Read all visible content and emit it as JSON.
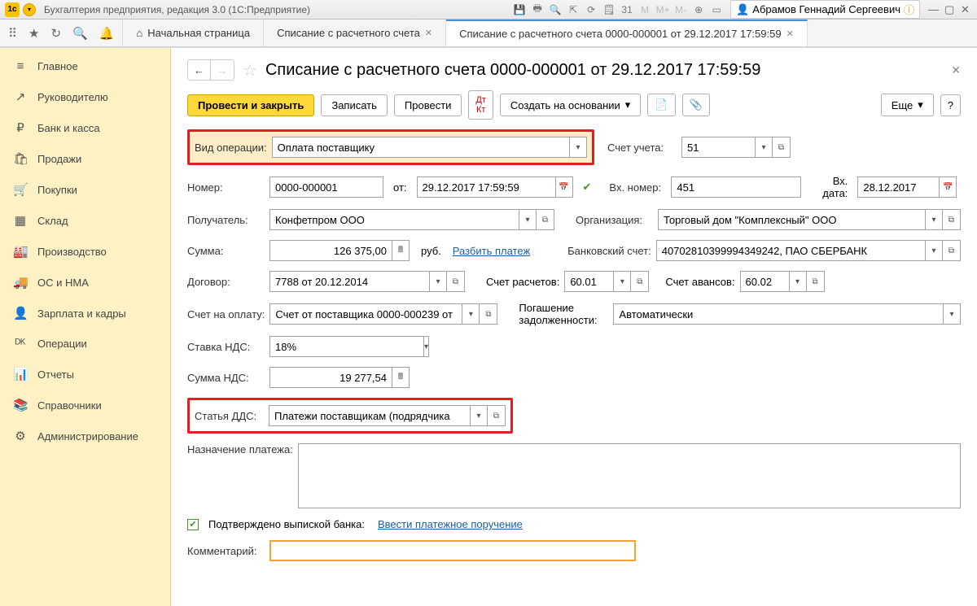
{
  "titlebar": {
    "app_title": "Бухгалтерия предприятия, редакция 3.0  (1С:Предприятие)",
    "user_name": "Абрамов Геннадий Сергеевич"
  },
  "tabs": {
    "home": "Начальная страница",
    "t1": "Списание с расчетного счета",
    "t2": "Списание с расчетного счета 0000-000001 от 29.12.2017 17:59:59"
  },
  "sidebar": {
    "items": [
      {
        "icon": "≡",
        "label": "Главное"
      },
      {
        "icon": "↗",
        "label": "Руководителю"
      },
      {
        "icon": "₽",
        "label": "Банк и касса"
      },
      {
        "icon": "🛍",
        "label": "Продажи"
      },
      {
        "icon": "🛒",
        "label": "Покупки"
      },
      {
        "icon": "▦",
        "label": "Склад"
      },
      {
        "icon": "🏭",
        "label": "Производство"
      },
      {
        "icon": "🚚",
        "label": "ОС и НМА"
      },
      {
        "icon": "👤",
        "label": "Зарплата и кадры"
      },
      {
        "icon": "ᴰᴷ",
        "label": "Операции"
      },
      {
        "icon": "📊",
        "label": "Отчеты"
      },
      {
        "icon": "📚",
        "label": "Справочники"
      },
      {
        "icon": "⚙",
        "label": "Администрирование"
      }
    ]
  },
  "page": {
    "title": "Списание с расчетного счета 0000-000001 от 29.12.2017 17:59:59"
  },
  "toolbar": {
    "primary": "Провести и закрыть",
    "save": "Записать",
    "post": "Провести",
    "create_based": "Создать на основании",
    "more": "Еще"
  },
  "form": {
    "op_type_label": "Вид операции:",
    "op_type_value": "Оплата поставщику",
    "account_label": "Счет учета:",
    "account_value": "51",
    "number_label": "Номер:",
    "number_value": "0000-000001",
    "from_label": "от:",
    "date_value": "29.12.2017 17:59:59",
    "in_number_label": "Вх. номер:",
    "in_number_value": "451",
    "in_date_label": "Вх. дата:",
    "in_date_value": "28.12.2017",
    "recipient_label": "Получатель:",
    "recipient_value": "Конфетпром ООО",
    "org_label": "Организация:",
    "org_value": "Торговый дом \"Комплексный\" ООО",
    "sum_label": "Сумма:",
    "sum_value": "126 375,00",
    "currency": "руб.",
    "split_link": "Разбить платеж",
    "bank_account_label": "Банковский счет:",
    "bank_account_value": "40702810399994349242, ПАО СБЕРБАНК",
    "contract_label": "Договор:",
    "contract_value": "7788 от 20.12.2014",
    "settlement_acc_label": "Счет расчетов:",
    "settlement_acc_value": "60.01",
    "advance_acc_label": "Счет авансов:",
    "advance_acc_value": "60.02",
    "invoice_label": "Счет на оплату:",
    "invoice_value": "Счет от поставщика 0000-000239 от",
    "debt_label": "Погашение задолженности:",
    "debt_value": "Автоматически",
    "vat_rate_label": "Ставка НДС:",
    "vat_rate_value": "18%",
    "vat_sum_label": "Сумма НДС:",
    "vat_sum_value": "19 277,54",
    "dds_label": "Статья ДДС:",
    "dds_value": "Платежи поставщикам (подрядчика",
    "purpose_label": "Назначение платежа:",
    "purpose_value": "",
    "confirmed_label": "Подтверждено выпиской банка:",
    "enter_order_link": "Ввести платежное поручение",
    "comment_label": "Комментарий:",
    "comment_value": ""
  }
}
